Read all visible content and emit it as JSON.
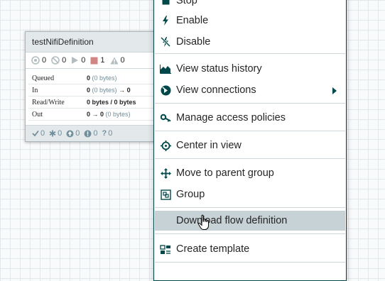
{
  "process_group": {
    "title": "testNifiDefinition",
    "status": {
      "transmitting": "0",
      "not_transmitting": "0",
      "running": "0",
      "stopped": "1",
      "invalid": "0"
    },
    "stats": [
      {
        "label": "Queued",
        "count": "0",
        "detail": "(0 bytes)",
        "tail": ""
      },
      {
        "label": "In",
        "count": "0",
        "detail": "(0 bytes)",
        "tail": "→ 0"
      },
      {
        "label": "Read/Write",
        "count": "",
        "detail": "0 bytes / 0 bytes",
        "tail": ""
      },
      {
        "label": "Out",
        "count": "0 → 0",
        "detail": "(0 bytes)",
        "tail": ""
      }
    ],
    "footer": {
      "up_to_date": "0",
      "locally_modified": "0",
      "stale": "0",
      "modified_and_stale": "0",
      "sync_failure": "0"
    }
  },
  "menu": {
    "stop": "Stop",
    "enable": "Enable",
    "disable": "Disable",
    "view_status_history": "View status history",
    "view_connections": "View connections",
    "manage_access_policies": "Manage access policies",
    "center_in_view": "Center in view",
    "move_to_parent_group": "Move to parent group",
    "group": "Group",
    "download_flow_definition": "Download flow definition",
    "create_template": "Create template"
  },
  "colors": {
    "accent_dark": "#004849",
    "stopped_red": "#d18686",
    "highlight": "#c7d2d7",
    "muted": "#728e9b"
  }
}
